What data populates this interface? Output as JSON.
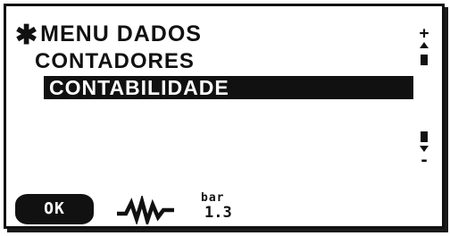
{
  "menu": {
    "title_symbol": "✱",
    "title": "MENU DADOS",
    "submenu": "CONTADORES",
    "selected_item": "CONTABILIDADE"
  },
  "scrollbar": {
    "up_symbol": "+",
    "down_symbol": "-"
  },
  "footer": {
    "ok_label": "OK",
    "wave_icon": "waveform-icon",
    "pressure_unit": "bar",
    "pressure_value": "1.3"
  },
  "colors": {
    "foreground": "#111111",
    "background": "#ffffff"
  }
}
